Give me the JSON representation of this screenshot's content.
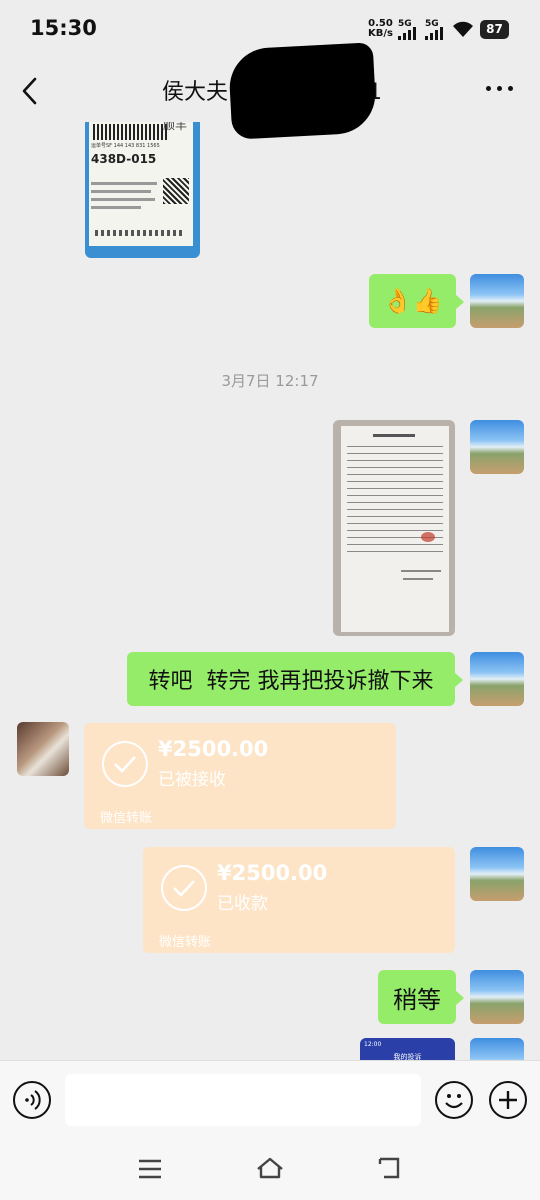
{
  "status_bar": {
    "time": "15:30",
    "net_speed_value": "0.50",
    "net_speed_unit": "KB/s",
    "sim1": "5G",
    "sim2": "5G",
    "battery": "87"
  },
  "header": {
    "title": "侯大夫13384142441",
    "back_icon": "chevron-left-icon",
    "more_icon": "more-horizontal-icon"
  },
  "messages": {
    "emoji_reply": "👌👍",
    "timestamp": "3月7日 12:17",
    "text1": "转吧  转完 我再把投诉撤下来",
    "transfer_received": {
      "amount": "¥2500.00",
      "status": "已被接收",
      "brand": "微信转账"
    },
    "transfer_sent": {
      "amount": "¥2500.00",
      "status": "已收款",
      "brand": "微信转账"
    },
    "text2": "稍等"
  },
  "photo_label": {
    "code": "438D-015",
    "tracking": "运单号SF 144 143 831 1565",
    "brand_mark": "顺丰"
  },
  "photo_preview": {
    "time": "12:00",
    "title": "我的投诉"
  },
  "input_bar": {
    "voice_icon": "voice-icon",
    "emoji_icon": "emoji-icon",
    "plus_icon": "plus-icon",
    "placeholder": ""
  },
  "nav_bar": {
    "menu_icon": "menu-icon",
    "home_icon": "home-icon",
    "back_icon": "back-icon"
  },
  "colors": {
    "bubble_green": "#95ec69",
    "transfer_orange": "#fde4c6",
    "background": "#ededed"
  }
}
